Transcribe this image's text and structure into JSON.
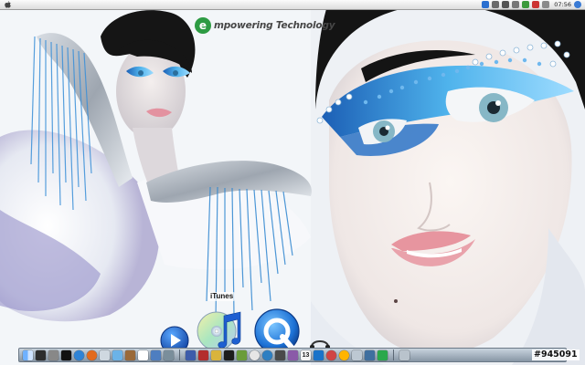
{
  "menubar": {
    "apple_icon": "apple-icon",
    "clock": "07:56"
  },
  "wallpaper": {
    "brand_text": "mpowering Technology",
    "brand_logo_letter": "e"
  },
  "dock": {
    "hovered_tooltip": "iTunes",
    "large_icons": [
      "play-icon",
      "itunes-icon",
      "quicktime-icon"
    ],
    "bar_items": [
      "finder",
      "app",
      "app",
      "app",
      "app",
      "app",
      "app",
      "app",
      "app",
      "app",
      "app",
      "app",
      "app",
      "app",
      "app",
      "app",
      "app",
      "app",
      "app",
      "app",
      "app",
      "app",
      "app",
      "app",
      "app",
      "app",
      "app",
      "app",
      "app",
      "app",
      "app",
      "app"
    ],
    "calendar_day": "13"
  },
  "watermark": {
    "post_id": "#945091"
  },
  "colors": {
    "wallpaper_light": "#f4f7fa",
    "eye_blue": "#2f8fd8",
    "hair": "#141414",
    "lips": "#e79aa4",
    "dock_bar": "#9aa8b6"
  }
}
